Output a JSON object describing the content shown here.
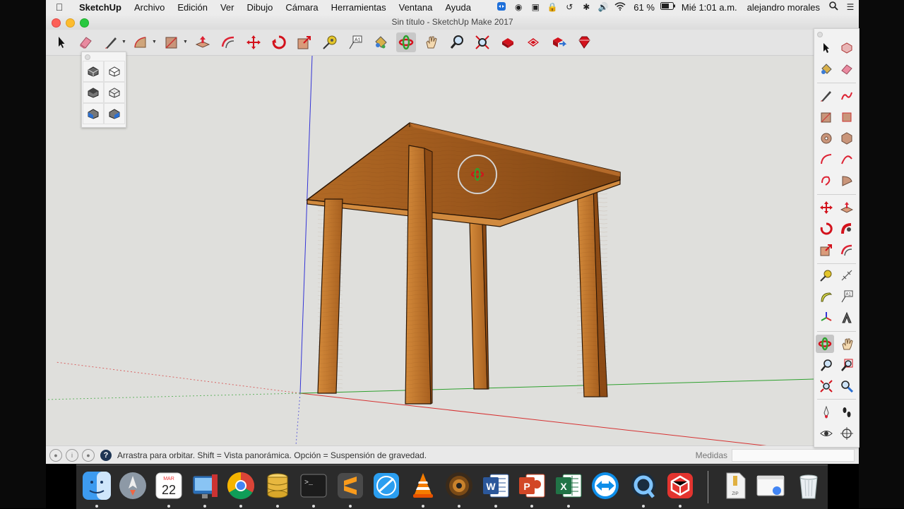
{
  "menubar": {
    "app_name": "SketchUp",
    "items": [
      "Archivo",
      "Edición",
      "Ver",
      "Dibujo",
      "Cámara",
      "Herramientas",
      "Ventana",
      "Ayuda"
    ],
    "battery": "61 %",
    "clock": "Mié 1:01 a.m.",
    "user": "alejandro morales"
  },
  "window": {
    "title": "Sin título - SketchUp Make 2017"
  },
  "toolbar": {
    "tools": [
      "select",
      "eraser",
      "line",
      "arc",
      "rectangle",
      "push-pull",
      "offset",
      "move",
      "rotate",
      "scale",
      "tape-measure",
      "text",
      "paint-bucket",
      "orbit",
      "pan",
      "zoom",
      "zoom-extents",
      "3d-warehouse",
      "extension-warehouse",
      "share-model",
      "ruby"
    ],
    "active_tool": "orbit"
  },
  "right_palette": {
    "active_tool": "orbit"
  },
  "status": {
    "message": "Arrastra para orbitar. Shift = Vista panorámica. Opción = Suspensión de gravedad.",
    "measurements_label": "Medidas",
    "measurements_value": "",
    "help_glyph": "?"
  },
  "dock": {
    "calendar_month": "MAR",
    "calendar_day": "22",
    "apps": [
      "finder",
      "launchpad",
      "calendar",
      "photo-booth",
      "chrome",
      "sequel-pro",
      "terminal",
      "sublime-text",
      "safari-like",
      "vlc",
      "speaker-app",
      "word",
      "powerpoint",
      "excel",
      "teamviewer",
      "quicktime",
      "sketchup",
      "archive",
      "browser-window",
      "trash"
    ]
  },
  "colors": {
    "axis_red": "#d63232",
    "axis_green": "#2fa12f",
    "axis_blue": "#3434d6",
    "wood_light": "#c77a2c",
    "wood_dark": "#8c4d16",
    "viewport_bg": "#dfdfdc"
  }
}
